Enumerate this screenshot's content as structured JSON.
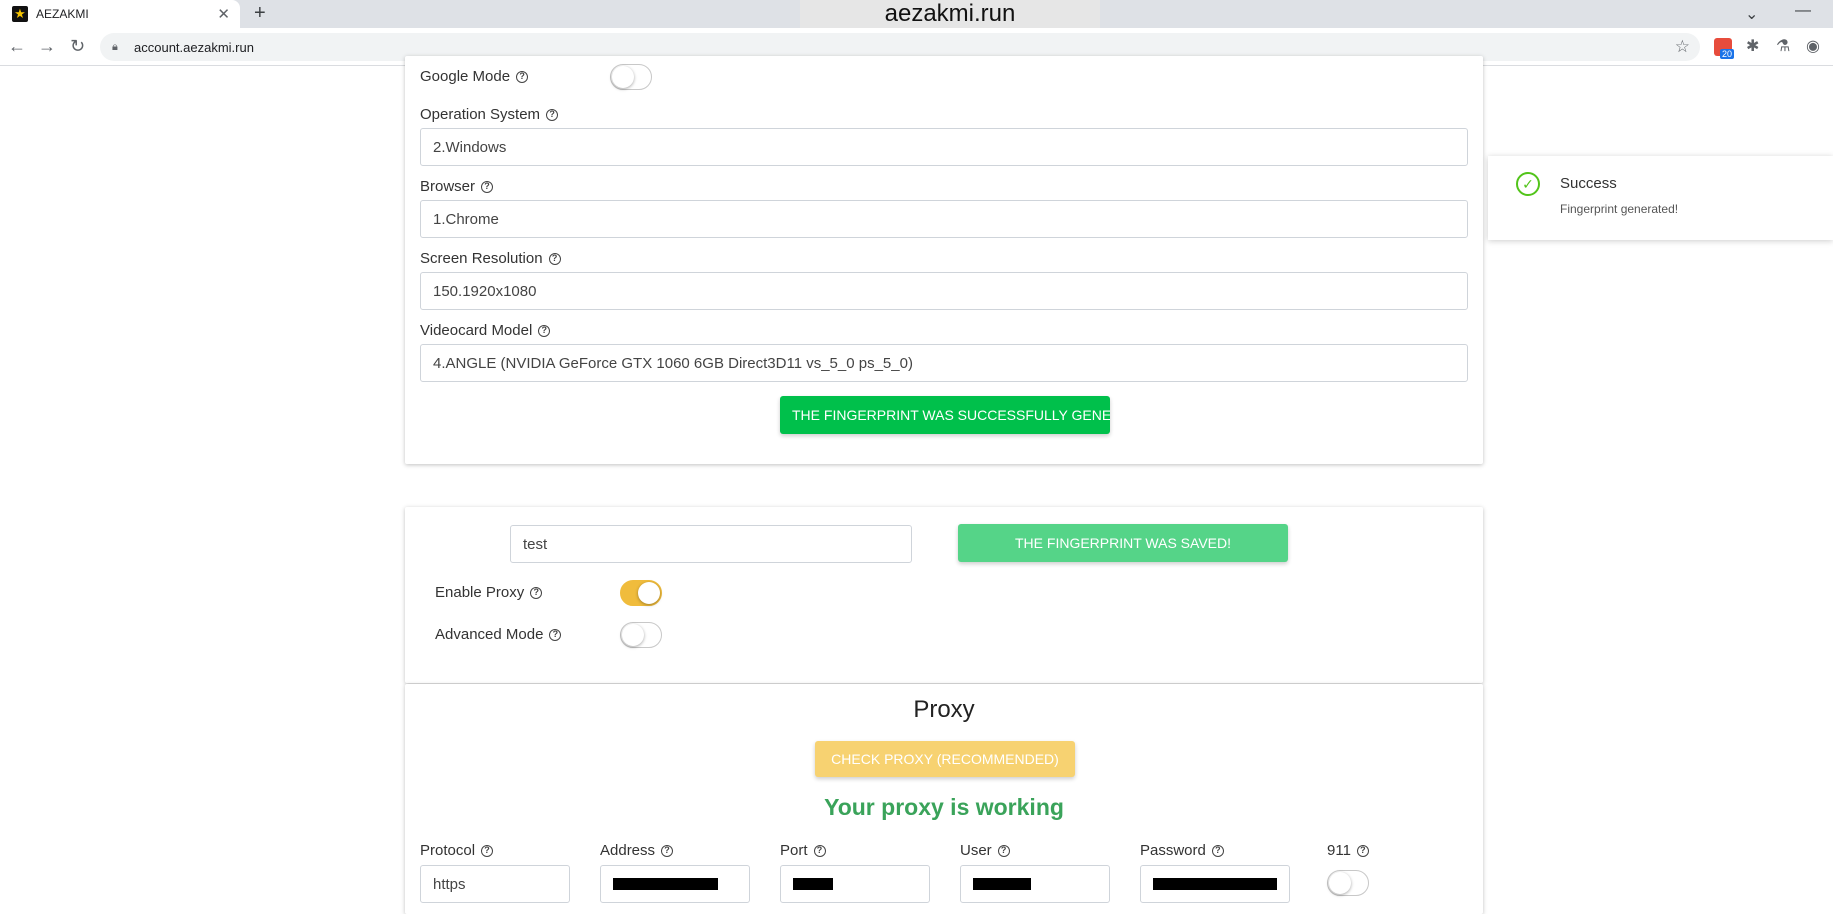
{
  "browser": {
    "tab_title": "AEZAKMI",
    "window_title": "aezakmi.run",
    "url": "account.aezakmi.run",
    "extension_badge": "20"
  },
  "fingerprint": {
    "google_mode_label": "Google Mode",
    "os_label": "Operation System",
    "os_value": "2.Windows",
    "browser_label": "Browser",
    "browser_value": "1.Chrome",
    "resolution_label": "Screen Resolution",
    "resolution_value": "150.1920x1080",
    "videocard_label": "Videocard Model",
    "videocard_value": "4.ANGLE (NVIDIA GeForce GTX 1060 6GB Direct3D11 vs_5_0 ps_5_0)",
    "generate_button_label": "THE FINGERPRINT WAS SUCCESSFULLY GENE",
    "google_mode_on": false
  },
  "profile": {
    "name_value": "test",
    "saved_button_label": "THE FINGERPRINT WAS SAVED!",
    "enable_proxy_label": "Enable Proxy",
    "enable_proxy_on": true,
    "advanced_mode_label": "Advanced Mode",
    "advanced_mode_on": false
  },
  "proxy": {
    "title": "Proxy",
    "check_button_label": "CHECK PROXY (RECOMMENDED)",
    "status_text": "Your proxy is working",
    "protocol_label": "Protocol",
    "protocol_value": "https",
    "address_label": "Address",
    "port_label": "Port",
    "user_label": "User",
    "password_label": "Password",
    "n911_label": "911",
    "n911_on": false
  },
  "toast": {
    "title": "Success",
    "message": "Fingerprint generated!"
  },
  "colors": {
    "generate_button": "#00c04b",
    "saved_button": "#55d488",
    "check_button": "#f7d271",
    "status_text": "#3aa35a",
    "toggle_on": "#f0bc3c"
  }
}
